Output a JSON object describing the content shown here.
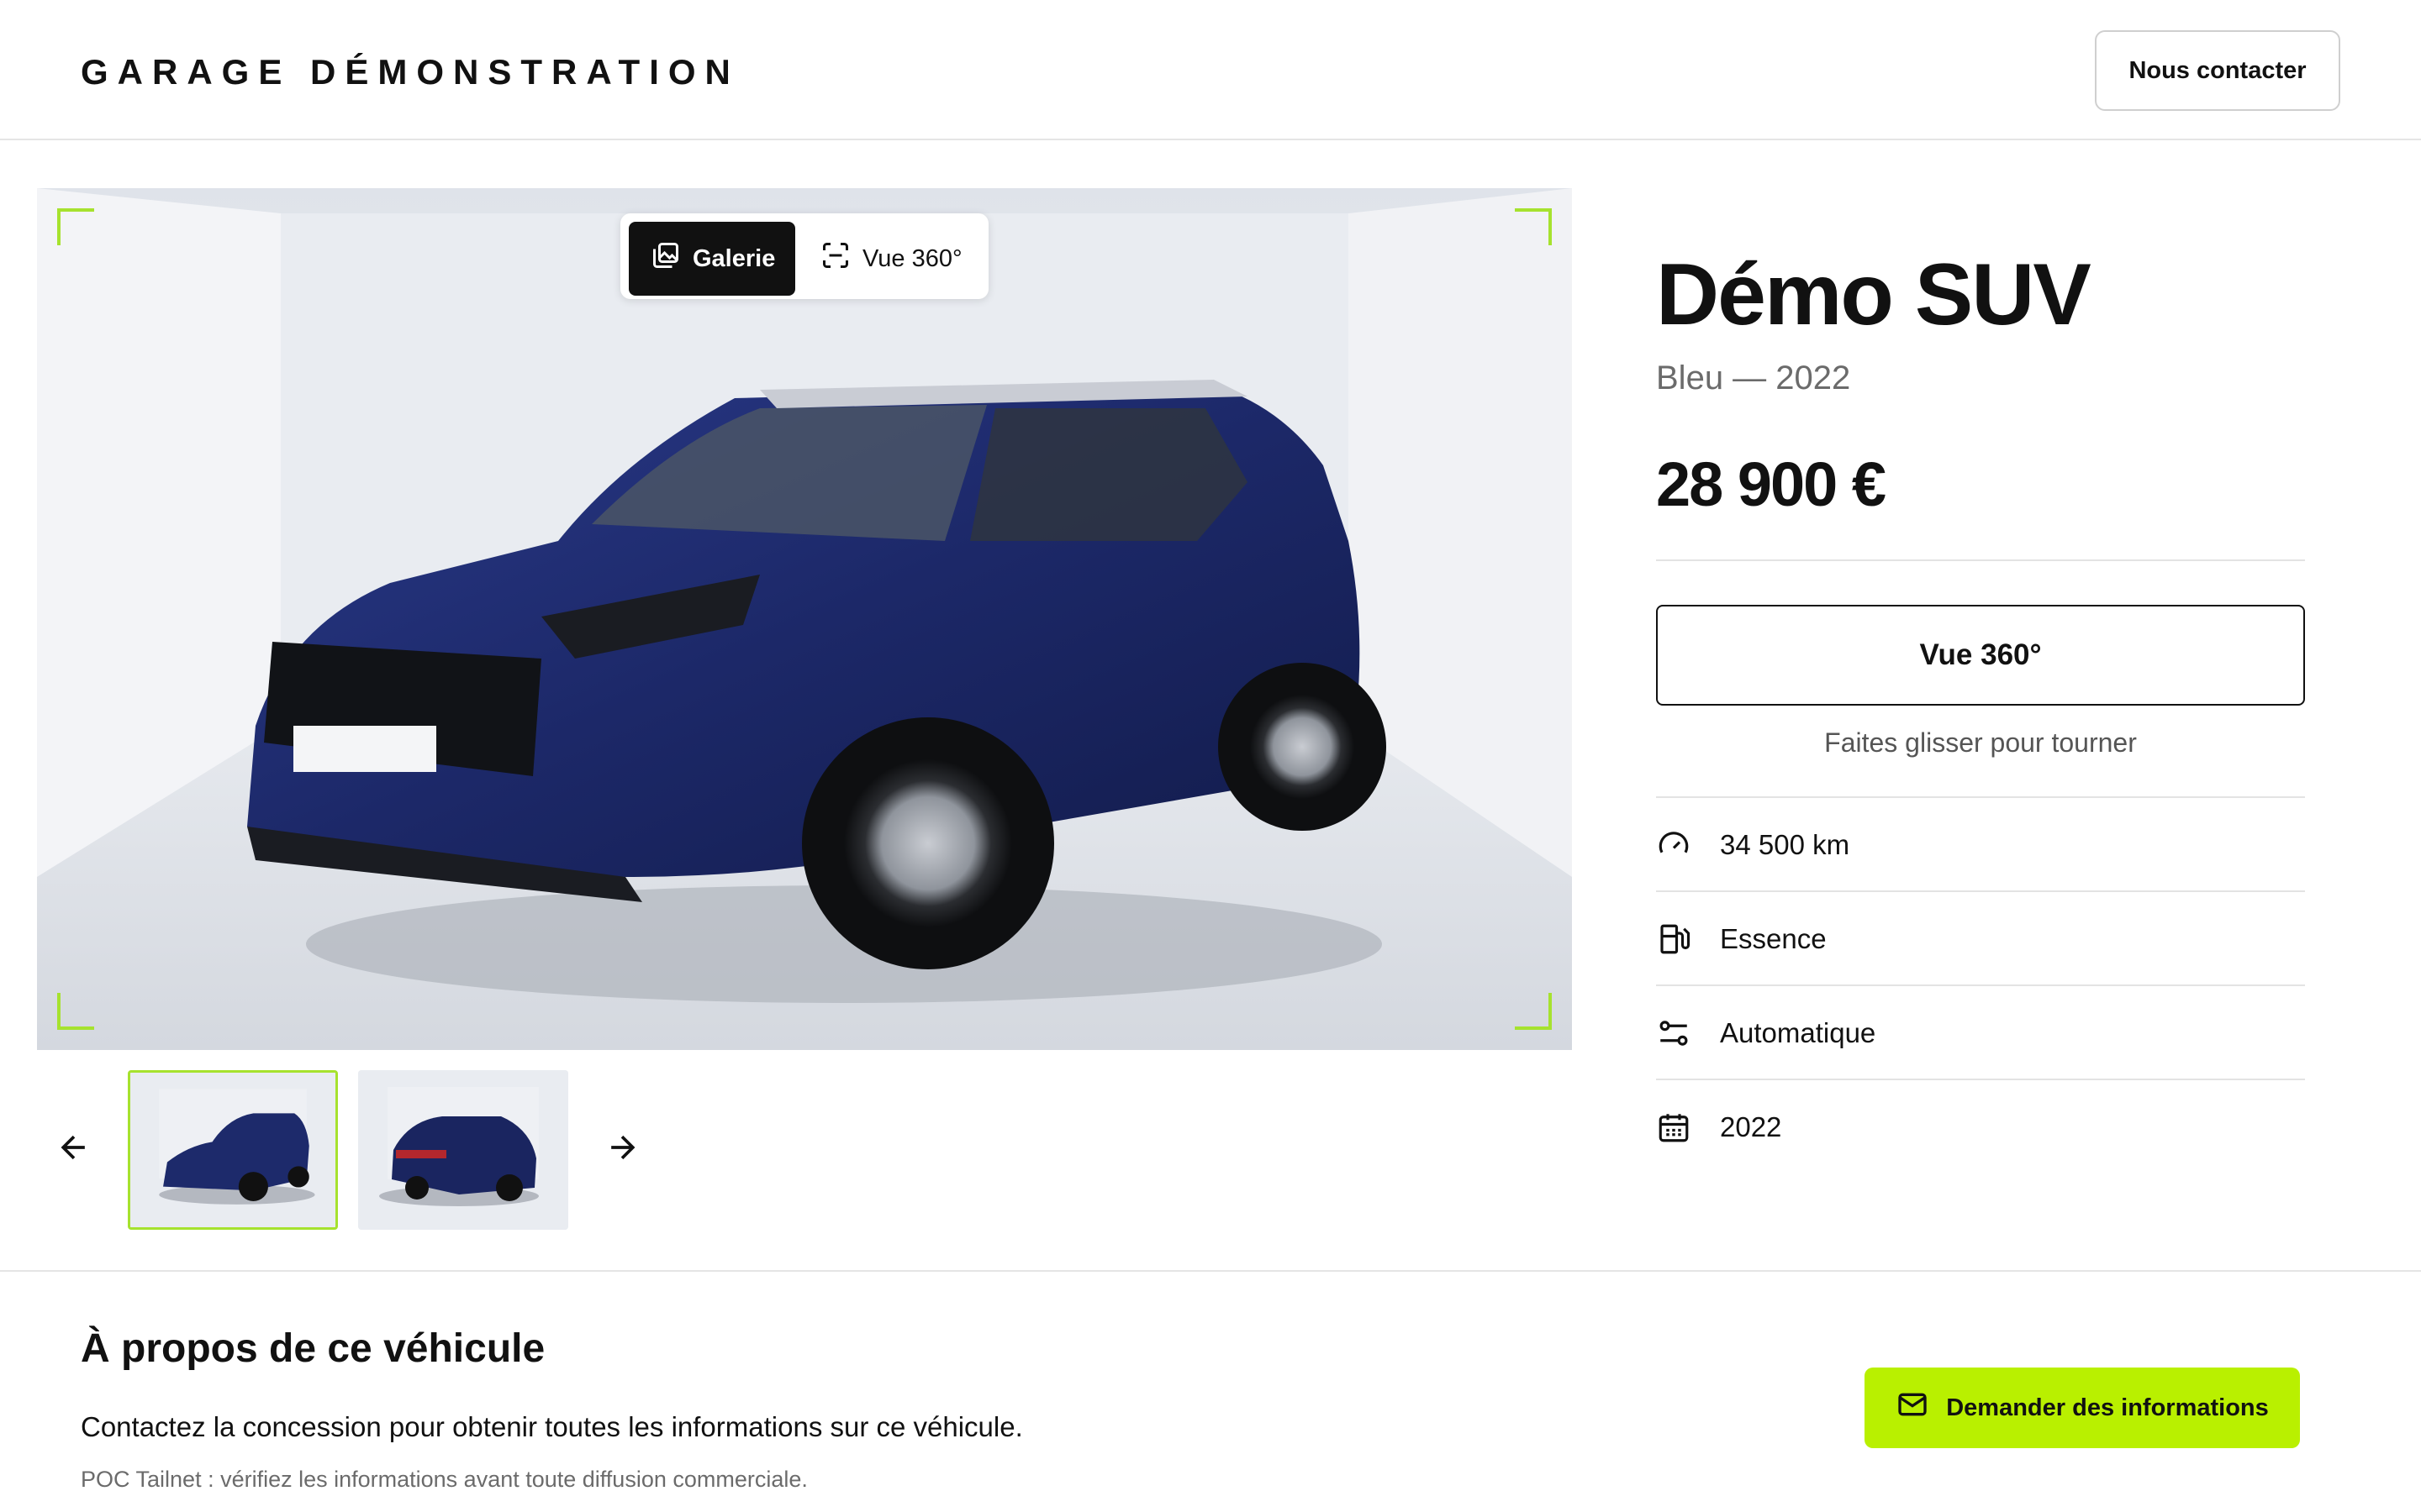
{
  "header": {
    "brand": "GARAGE DÉMONSTRATION",
    "contact_label": "Nous contacter"
  },
  "viewer": {
    "tabs": [
      {
        "label": "Galerie",
        "icon": "gallery-icon",
        "active": true
      },
      {
        "label": "Vue 360°",
        "icon": "scan-icon",
        "active": false
      }
    ],
    "corner_color": "#a6e22e",
    "thumbnails": [
      {
        "name": "front-three-quarter",
        "selected": true
      },
      {
        "name": "rear-three-quarter",
        "selected": false
      }
    ]
  },
  "vehicle": {
    "title": "Démo SUV",
    "subtitle": "Bleu — 2022",
    "price": "28 900 €",
    "view360_label": "Vue 360°",
    "drag_hint": "Faites glisser pour tourner",
    "specs": [
      {
        "icon": "speedometer-icon",
        "value": "34 500 km"
      },
      {
        "icon": "fuel-pump-icon",
        "value": "Essence"
      },
      {
        "icon": "gearbox-icon",
        "value": "Automatique"
      },
      {
        "icon": "calendar-icon",
        "value": "2022"
      }
    ]
  },
  "about": {
    "title": "À propos de ce véhicule",
    "text": "Contactez la concession pour obtenir toutes les informations sur ce véhicule.",
    "note": "POC Tailnet : vérifiez les informations avant toute diffusion commerciale.",
    "cta_label": "Demander des informations"
  },
  "colors": {
    "accent": "#b9f000",
    "corner": "#a6e22e",
    "car_body": "#1d2a6b"
  }
}
